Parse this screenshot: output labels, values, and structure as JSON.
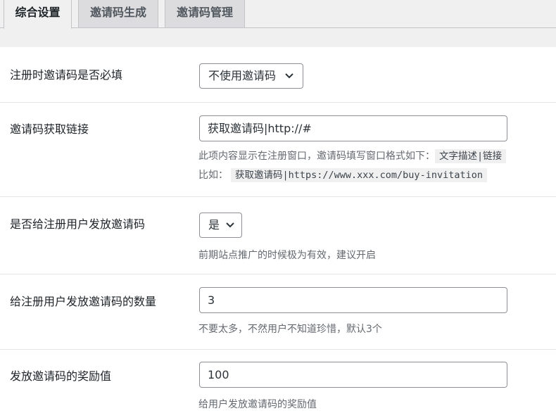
{
  "tabs": [
    {
      "label": "综合设置",
      "active": true
    },
    {
      "label": "邀请码生成",
      "active": false
    },
    {
      "label": "邀请码管理",
      "active": false
    }
  ],
  "settings": {
    "required": {
      "label": "注册时邀请码是否必填",
      "value": "不使用邀请码"
    },
    "link": {
      "label": "邀请码获取链接",
      "value": "获取邀请码|http://#",
      "desc_text": "此项内容显示在注册窗口，邀请码填写窗口格式如下：",
      "desc_code": "文字描述|链接",
      "example_prefix": "比如：",
      "example_code": "获取邀请码|https://www.xxx.com/buy-invitation"
    },
    "give": {
      "label": "是否给注册用户发放邀请码",
      "value": "是",
      "desc": "前期站点推广的时候极为有效，建议开启"
    },
    "count": {
      "label": "给注册用户发放邀请码的数量",
      "value": "3",
      "desc": "不要太多，不然用户不知道珍惜，默认3个"
    },
    "reward": {
      "label": "发放邀请码的奖励值",
      "value": "100",
      "desc": "给用户发放邀请码的奖励值"
    }
  }
}
